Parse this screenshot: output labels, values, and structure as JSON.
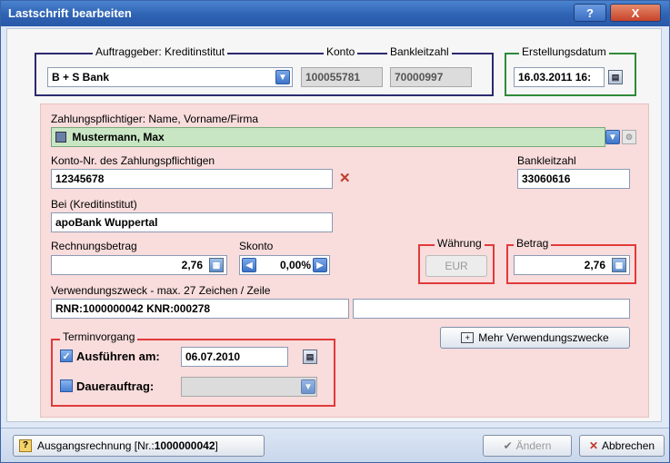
{
  "window": {
    "title": "Lastschrift bearbeiten",
    "help_label": "?",
    "close_label": "X"
  },
  "header": {
    "auftraggeber_label": "Auftraggeber: Kreditinstitut",
    "bank_value": "B + S Bank",
    "konto_label": "Konto",
    "konto_value": "100055781",
    "blz_label": "Bankleitzahl",
    "blz_value": "70000997",
    "erstellungsdatum_label": "Erstellungsdatum",
    "erstellungsdatum_value": "16.03.2011 16:"
  },
  "form": {
    "zahlungspflichtiger_label": "Zahlungspflichtiger: Name, Vorname/Firma",
    "zahlungspflichtiger_value": "Mustermann, Max",
    "kontonr_label": "Konto-Nr. des Zahlungspflichtigen",
    "kontonr_value": "12345678",
    "blz_label": "Bankleitzahl",
    "blz_value": "33060616",
    "bei_label": "Bei (Kreditinstitut)",
    "bei_value": "apoBank Wuppertal",
    "rechnungsbetrag_label": "Rechnungsbetrag",
    "rechnungsbetrag_value": "2,76",
    "skonto_label": "Skonto",
    "skonto_value": "0,00%",
    "waehrung_label": "Währung",
    "waehrung_value": "EUR",
    "betrag_label": "Betrag",
    "betrag_value": "2,76",
    "verwendungszweck_label": "Verwendungszweck - max. 27 Zeichen / Zeile",
    "verwendungszweck_value": "RNR:1000000042 KNR:000278",
    "verwendungszweck2_value": "",
    "mehr_button": "Mehr Verwendungszwecke",
    "termin_label": "Terminvorgang",
    "ausfuehren_label": "Ausführen am:",
    "ausfuehren_value": "06.07.2010",
    "dauerauftrag_label": "Dauerauftrag:"
  },
  "footer": {
    "ausgangsrechnung_label": "Ausgangsrechnung [Nr.: ",
    "ausgangsrechnung_nr": "1000000042",
    "ausgangsrechnung_end": "]",
    "aendern_label": "Ändern",
    "abbrechen_label": "Abbrechen"
  },
  "colors": {
    "titlebar": "#2f63b4",
    "bank_frame": "#2b2a6e",
    "date_frame": "#2f8a3a",
    "highlight_frame": "#e03a3a",
    "pink_panel": "#f9dcdc",
    "green_field": "#c8e6c4"
  }
}
